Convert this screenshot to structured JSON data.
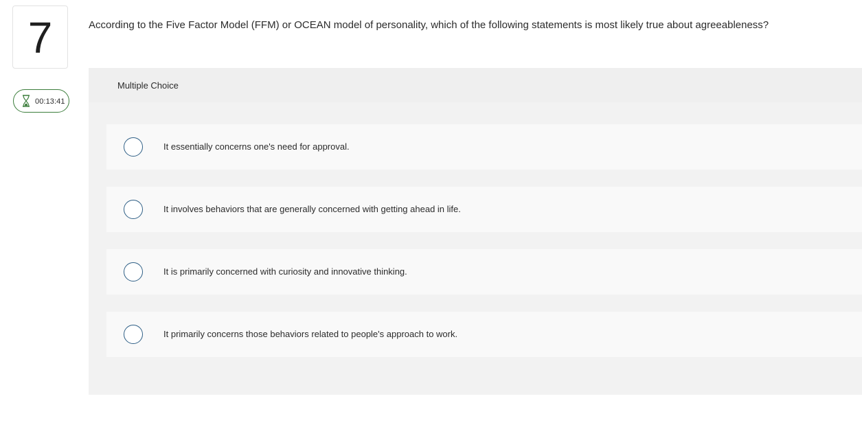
{
  "question": {
    "number": "7",
    "text": "According to the Five Factor Model (FFM) or OCEAN model of personality, which of the following statements is most likely true about agreeableness?"
  },
  "timer": {
    "icon": "hourglass-icon",
    "value": "00:13:41",
    "border_color": "#3b7d3b"
  },
  "answer_panel": {
    "type_label": "Multiple Choice",
    "options": [
      {
        "label": "It essentially concerns one's need for approval.",
        "selected": false
      },
      {
        "label": "It involves behaviors that are generally concerned with getting ahead in life.",
        "selected": false
      },
      {
        "label": "It is primarily concerned with curiosity and innovative thinking.",
        "selected": false
      },
      {
        "label": "It primarily concerns those behaviors related to people's approach to work.",
        "selected": false
      }
    ]
  },
  "colors": {
    "radio_border": "#2f5f86",
    "panel_bg": "#f2f2f2",
    "option_bg": "#f9f9f9"
  }
}
